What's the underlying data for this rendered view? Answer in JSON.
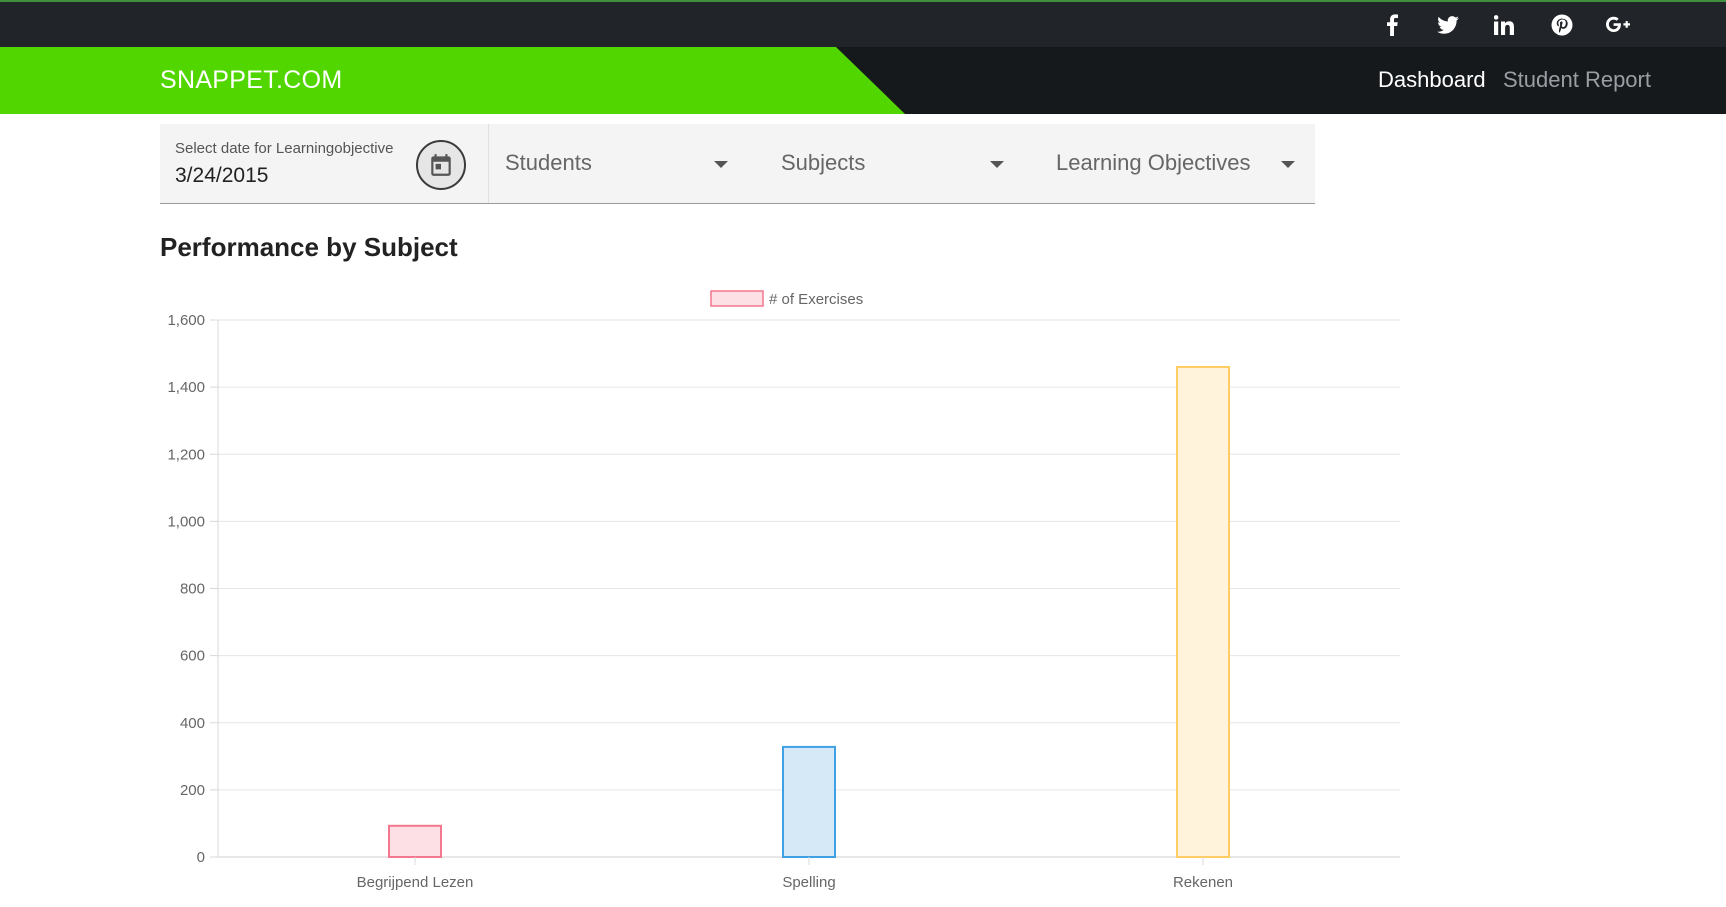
{
  "social": {
    "icons": [
      {
        "name": "facebook-icon",
        "glyph": "f"
      },
      {
        "name": "twitter-icon",
        "glyph": "twitter"
      },
      {
        "name": "linkedin-icon",
        "glyph": "in"
      },
      {
        "name": "pinterest-icon",
        "glyph": "p"
      },
      {
        "name": "google-plus-icon",
        "glyph": "g+"
      }
    ]
  },
  "nav": {
    "brand": "SNAPPET.COM",
    "links": [
      "Dashboard",
      "Student Report"
    ],
    "brand_color": "#52d600"
  },
  "filters": {
    "date_label": "Select date for Learningobjective",
    "date_value": "3/24/2015",
    "calendar_icon": "calendar-icon",
    "students": "Students",
    "subjects": "Subjects",
    "objectives": "Learning Objectives"
  },
  "section": {
    "title": "Performance by Subject"
  },
  "chart_data": {
    "type": "bar",
    "categories": [
      "Begrijpend Lezen",
      "Spelling",
      "Rekenen"
    ],
    "series": [
      {
        "name": "# of Exercises",
        "values": [
          93,
          328,
          1460
        ]
      }
    ],
    "ylim": [
      0,
      1600
    ],
    "yticks": [
      "0",
      "200",
      "400",
      "600",
      "800",
      "1,000",
      "1,200",
      "1,400",
      "1,600"
    ],
    "legend": "top",
    "grid": true,
    "colors": {
      "fills": [
        "#fde0e6",
        "#d5e9f7",
        "#fff3dc"
      ],
      "borders": [
        "#f2778f",
        "#3fa0e3",
        "#ffcd63"
      ]
    }
  }
}
